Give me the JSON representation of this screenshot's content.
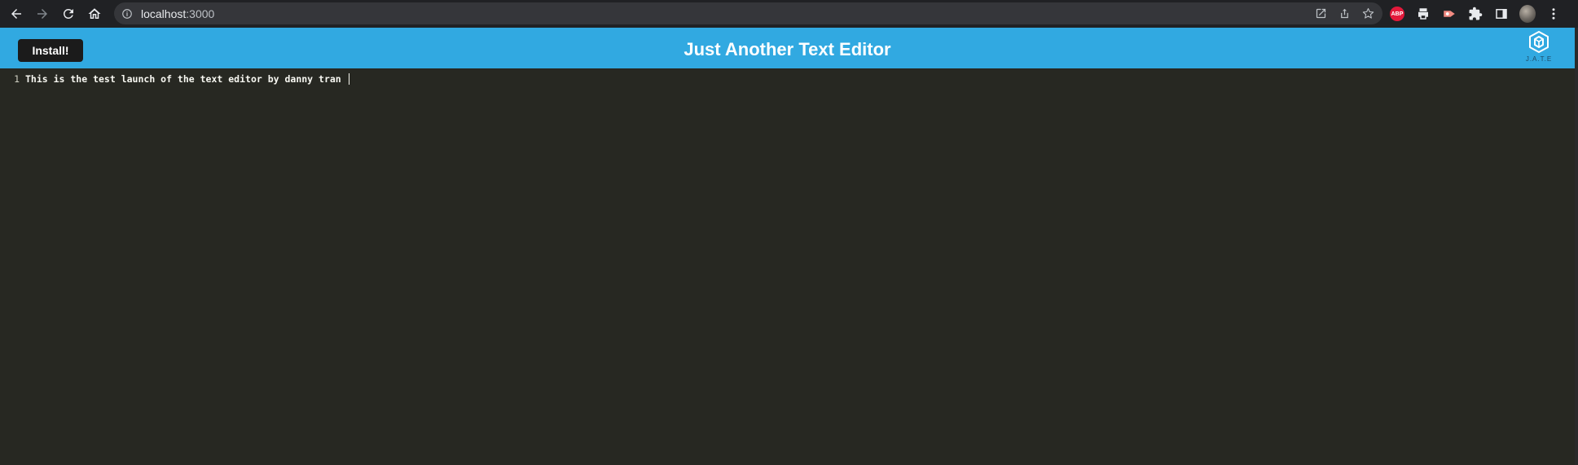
{
  "browser": {
    "url_host": "localhost",
    "url_port": ":3000",
    "extensions": [
      "open-in-new-icon",
      "share-icon",
      "star-icon",
      "abp-icon",
      "print-icon",
      "record-icon",
      "puzzle-icon",
      "sidebar-icon",
      "avatar",
      "kebab-menu-icon"
    ],
    "abp_label": "ABP"
  },
  "header": {
    "install_label": "Install!",
    "title": "Just Another Text Editor",
    "logo_text": "J.A.T.E",
    "background": "#31a9e1"
  },
  "editor": {
    "background": "#272822",
    "lines": [
      {
        "number": "1",
        "text": "This is the test launch of the text editor by danny tran "
      }
    ]
  }
}
